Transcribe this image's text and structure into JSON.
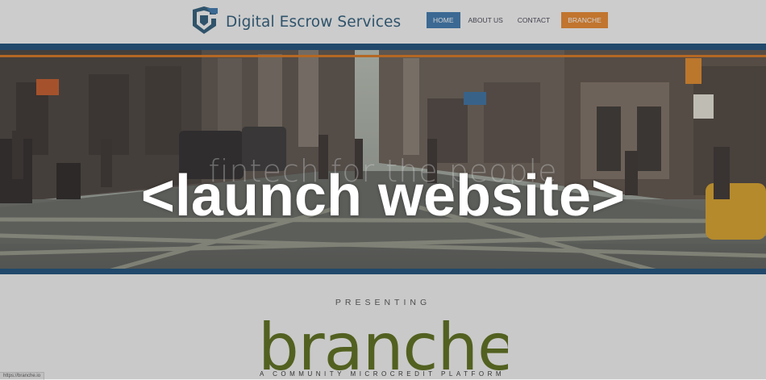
{
  "header": {
    "brand_name": "Digital Escrow Services",
    "nav": [
      {
        "label": "HOME"
      },
      {
        "label": "ABOUT US"
      },
      {
        "label": "CONTACT"
      },
      {
        "label": "BRANCHE"
      }
    ]
  },
  "hero": {
    "tagline": "fintech for the people"
  },
  "overlay": {
    "launch_label": "<launch website>"
  },
  "section": {
    "presenting": "PRESENTING",
    "product_name": "branche",
    "product_subtitle": "A COMMUNITY MICROCREDIT PLATFORM"
  },
  "status_bar": {
    "url": "https://branche.io"
  },
  "colors": {
    "brand_blue": "#2d5c7a",
    "nav_active": "#3d78ad",
    "nav_cta": "#e8872c",
    "band_blue": "#1d4f7a",
    "band_orange": "#d8761f",
    "product_green": "#5a6e1a"
  },
  "icons": {
    "logo": "escrow-shield-icon"
  }
}
